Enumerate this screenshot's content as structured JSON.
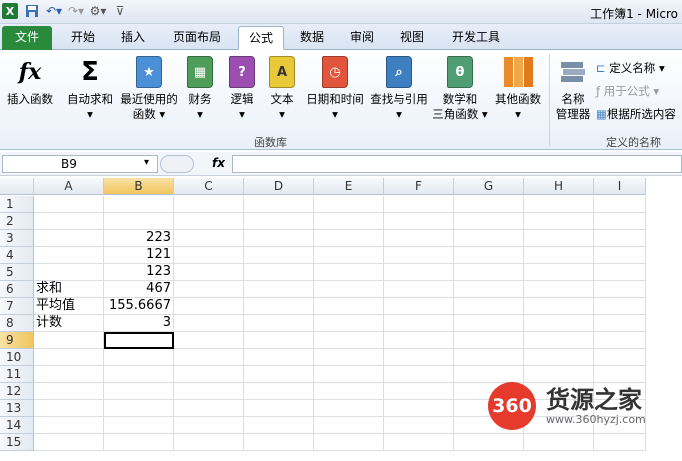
{
  "window": {
    "title": "工作簿1 - Micro"
  },
  "tabs": [
    {
      "label": "文件"
    },
    {
      "label": "开始"
    },
    {
      "label": "插入"
    },
    {
      "label": "页面布局"
    },
    {
      "label": "公式"
    },
    {
      "label": "数据"
    },
    {
      "label": "审阅"
    },
    {
      "label": "视图"
    },
    {
      "label": "开发工具"
    }
  ],
  "active_tab": "公式",
  "ribbon": {
    "insert_function": {
      "label": "插入函数",
      "icon": "fx"
    },
    "autosum": {
      "label": "自动求和",
      "icon": "Σ",
      "arrow": "▾"
    },
    "recent": {
      "label1": "最近使用的",
      "label2": "函数 ▾"
    },
    "financial": {
      "label": "财务",
      "arrow": "▾"
    },
    "logical": {
      "label": "逻辑",
      "arrow": "▾",
      "icon": "?"
    },
    "text": {
      "label": "文本",
      "arrow": "▾",
      "icon": "A"
    },
    "datetime": {
      "label": "日期和时间",
      "arrow": "▾"
    },
    "lookup": {
      "label": "查找与引用",
      "arrow": "▾"
    },
    "math": {
      "label1": "数学和",
      "label2": "三角函数 ▾",
      "icon": "θ"
    },
    "more": {
      "label": "其他函数",
      "arrow": "▾"
    },
    "group_label": "函数库",
    "name_manager": {
      "label1": "名称",
      "label2": "管理器"
    },
    "define_name": "定义名称 ▾",
    "use_in_formula": "用于公式 ▾",
    "create_from_selection": "根据所选内容",
    "defined_names_group": "定义的名称"
  },
  "formula_bar": {
    "name_box": "B9",
    "fx_label": "fx",
    "value": ""
  },
  "columns": [
    "A",
    "B",
    "C",
    "D",
    "E",
    "F",
    "G",
    "H",
    "I"
  ],
  "rows": [
    "1",
    "2",
    "3",
    "4",
    "5",
    "6",
    "7",
    "8",
    "9",
    "10",
    "11",
    "12",
    "13",
    "14",
    "15"
  ],
  "cells": {
    "B3": "223",
    "B4": "121",
    "B5": "123",
    "A6": "求和",
    "B6": "467",
    "A7": "平均值",
    "B7": "155.6667",
    "A8": "计数",
    "B8": "3"
  },
  "selected_cell": "B9",
  "watermark": {
    "logo": "360",
    "name": "货源之家",
    "url": "www.360hyzj.com"
  },
  "colors": {
    "accent": "#2a8a3c",
    "selection": "#f1c55c",
    "logo_red": "#e53a2c"
  }
}
